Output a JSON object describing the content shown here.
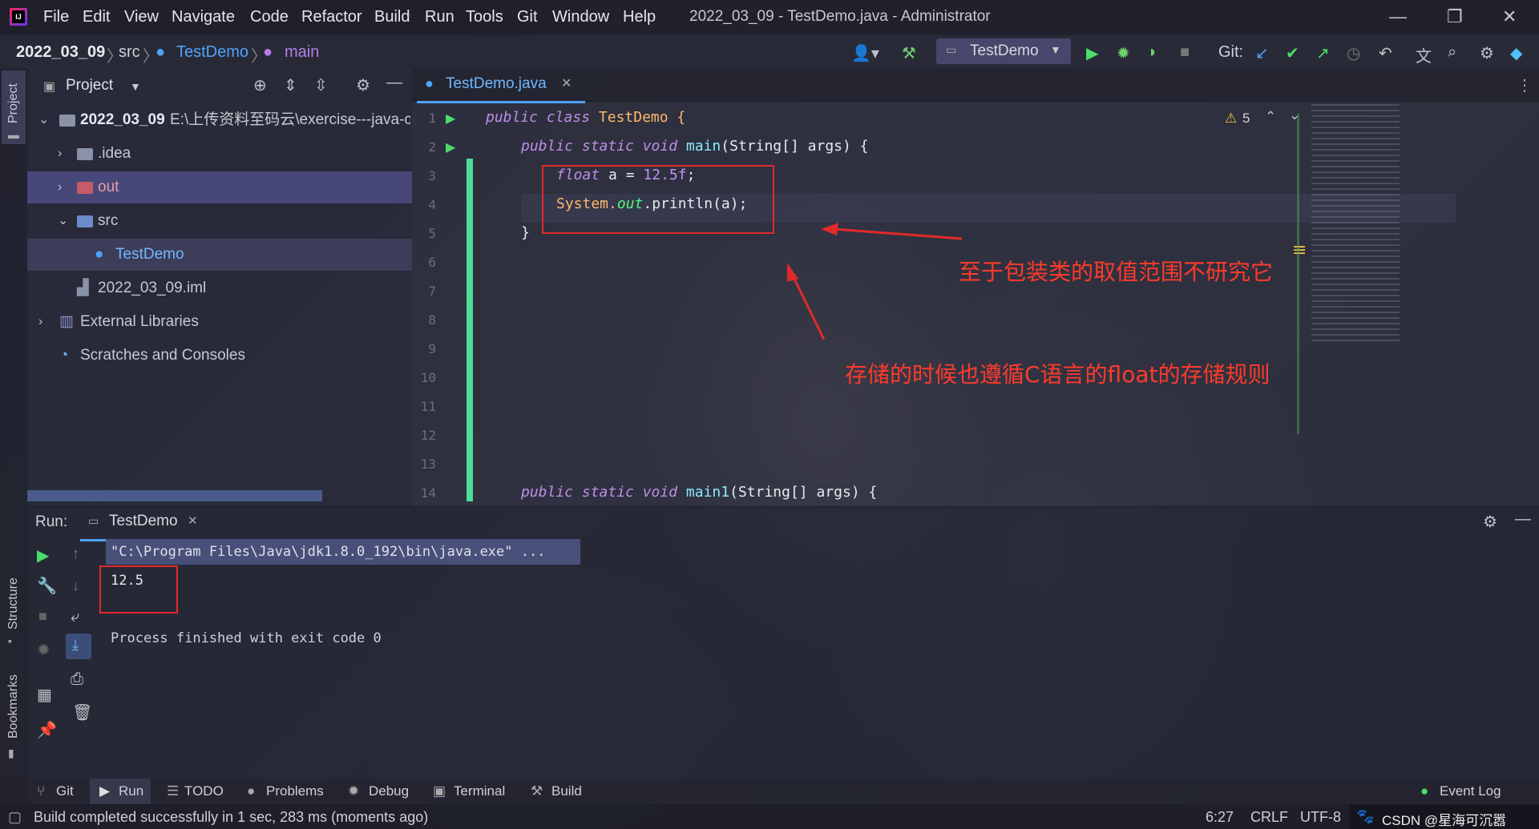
{
  "window": {
    "title": "2022_03_09 - TestDemo.java - Administrator",
    "menu": [
      "File",
      "Edit",
      "View",
      "Navigate",
      "Code",
      "Refactor",
      "Build",
      "Run",
      "Tools",
      "Git",
      "Window",
      "Help"
    ]
  },
  "navbar": {
    "breadcrumbs": [
      "2022_03_09",
      "src",
      "TestDemo",
      "main"
    ],
    "run_config": "TestDemo",
    "git_label": "Git:"
  },
  "project": {
    "title": "Project",
    "tree": [
      {
        "label": "2022_03_09",
        "path": "E:\\上传资料至码云\\exercise---java-c"
      },
      {
        "label": ".idea"
      },
      {
        "label": "out"
      },
      {
        "label": "src"
      },
      {
        "label": "TestDemo"
      },
      {
        "label": "2022_03_09.iml"
      },
      {
        "label": "External Libraries"
      },
      {
        "label": "Scratches and Consoles"
      }
    ]
  },
  "editor": {
    "tab": "TestDemo.java",
    "warnings": "5",
    "line_numbers": [
      "1",
      "2",
      "3",
      "4",
      "5",
      "6",
      "7",
      "8",
      "9",
      "10",
      "11",
      "12",
      "13",
      "14"
    ],
    "code": {
      "l1_a": "public class",
      "l1_b": "TestDemo {",
      "l2_a": "public static void",
      "l2_b": "main",
      "l2_c": "(String[] args) {",
      "l3_a": "float",
      "l3_b": "a = ",
      "l3_c": "12.5f",
      "l3_d": ";",
      "l4_a": "System.",
      "l4_b": "out",
      "l4_c": ".println(a);",
      "l5": "}",
      "l14_a": "public static void",
      "l14_b": "main1",
      "l14_c": "(String[] args) {"
    }
  },
  "annotations": {
    "a1": "至于包装类的取值范围不研究它",
    "a2": "存储的时候也遵循C语言的float的存储规则"
  },
  "run": {
    "label": "Run:",
    "tab": "TestDemo",
    "cmd": "\"C:\\Program Files\\Java\\jdk1.8.0_192\\bin\\java.exe\" ...",
    "output": "12.5",
    "exit": "Process finished with exit code 0"
  },
  "side": {
    "project": "Project",
    "structure": "Structure",
    "bookmarks": "Bookmarks"
  },
  "bottom_tools": [
    "Git",
    "Run",
    "TODO",
    "Problems",
    "Debug",
    "Terminal",
    "Build"
  ],
  "event_log": "Event Log",
  "status": {
    "message": "Build completed successfully in 1 sec, 283 ms (moments ago)",
    "position": "6:27",
    "line_sep": "CRLF",
    "encoding": "UTF-8",
    "watermark": "CSDN @星海可沉嚣"
  }
}
